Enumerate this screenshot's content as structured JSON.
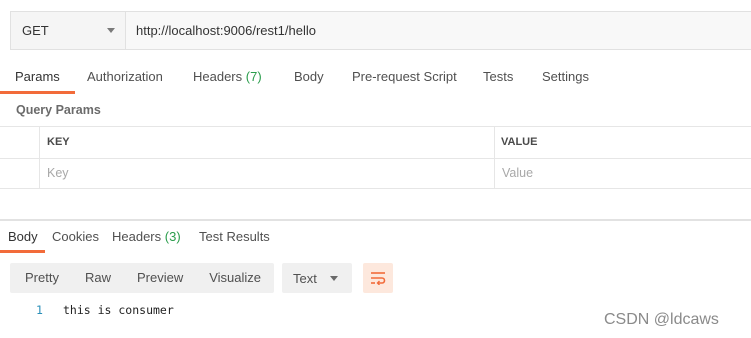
{
  "request": {
    "method": "GET",
    "url": "http://localhost:9006/rest1/hello"
  },
  "request_tabs": [
    {
      "label": "Params",
      "active": true
    },
    {
      "label": "Authorization"
    },
    {
      "label": "Headers",
      "count": "(7)"
    },
    {
      "label": "Body"
    },
    {
      "label": "Pre-request Script"
    },
    {
      "label": "Tests"
    },
    {
      "label": "Settings"
    }
  ],
  "query_params": {
    "title": "Query Params",
    "key_header": "KEY",
    "value_header": "VALUE",
    "key_placeholder": "Key",
    "value_placeholder": "Value"
  },
  "response_tabs": [
    {
      "label": "Body",
      "active": true
    },
    {
      "label": "Cookies"
    },
    {
      "label": "Headers",
      "count": "(3)"
    },
    {
      "label": "Test Results"
    }
  ],
  "view_modes": [
    "Pretty",
    "Raw",
    "Preview",
    "Visualize"
  ],
  "language": "Text",
  "wrap_icon": "wrap-lines-icon",
  "accent_color": "#f26b3a",
  "count_color": "#2a9d4c",
  "response_body": [
    {
      "line": "1",
      "text": "this is consumer"
    }
  ],
  "watermark": "CSDN @ldcaws"
}
